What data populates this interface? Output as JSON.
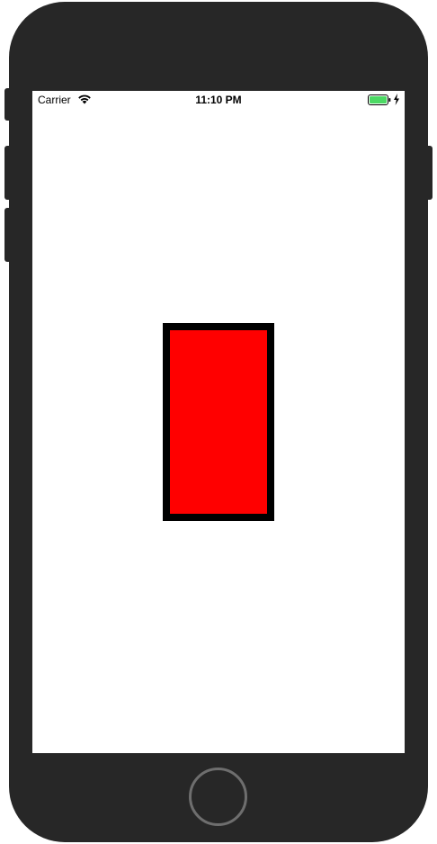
{
  "status_bar": {
    "carrier": "Carrier",
    "time": "11:10 PM",
    "wifi_icon": "wifi-icon",
    "battery_icon": "battery-full-icon",
    "charging_icon": "charging-bolt-icon",
    "battery_color": "#4cd964"
  },
  "device": {
    "frame_color": "#272727",
    "home_button_ring_color": "#6e6e6e"
  },
  "content": {
    "box_fill_color": "#ff0000",
    "box_border_color": "#000000"
  }
}
